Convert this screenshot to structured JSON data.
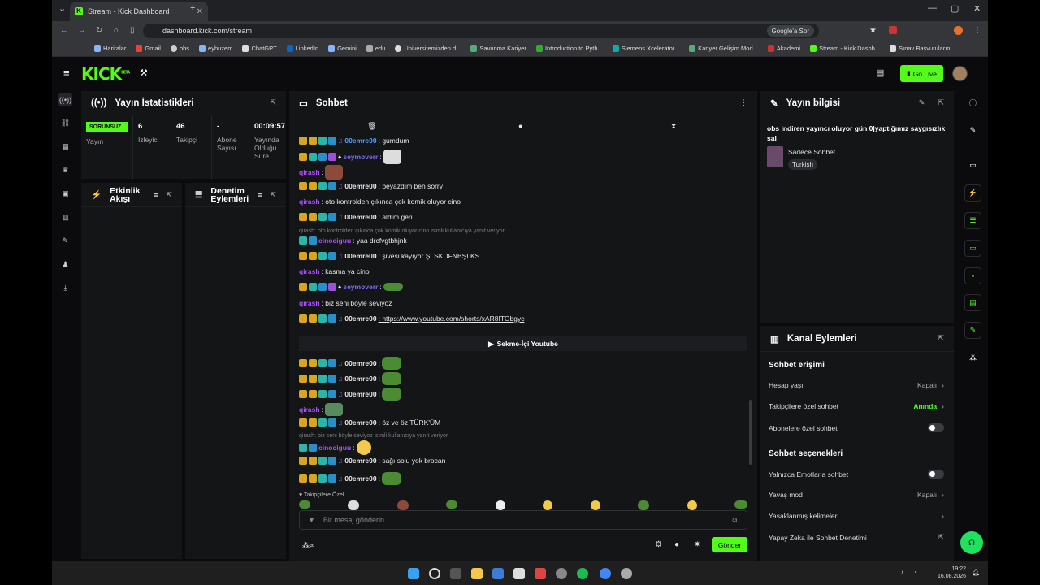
{
  "browser": {
    "tab_title": "Stream - Kick Dashboard",
    "url": "dashboard.kick.com/stream",
    "google_button": "Google'a Sor",
    "bookmarks": [
      "Haritalar",
      "Gmail",
      "obs",
      "eybuzem",
      "ChatGPT",
      "LinkedIn",
      "Gemini",
      "edu",
      "Üniversitemizden d...",
      "Savunma Kariyer",
      "Introduction to Pyth...",
      "Siemens Xcelerator...",
      "Kariyer Gelişim Mod...",
      "Akademi",
      "Stream - Kick Dashb...",
      "Sınav Başvurularını..."
    ]
  },
  "header": {
    "logo": "KICK",
    "logo_tag": "BETA",
    "go_live": "Go Live"
  },
  "stats": {
    "title": "Yayın İstatistikleri",
    "status_badge": "SORUNSUZ",
    "status_label": "Yayın",
    "viewers_value": "6",
    "viewers_label": "İzleyici",
    "followers_value": "46",
    "followers_label": "Takipçi",
    "subs_value": "-",
    "subs_label": "Abone Sayısı",
    "duration_value": "00:09:57",
    "duration_label": "Yayında Olduğu Süre"
  },
  "activity": {
    "title": "Etkinlik Akışı"
  },
  "moderation": {
    "title": "Denetim Eylemleri"
  },
  "chat": {
    "title": "Sohbet",
    "pinned": "Sekme-İçi Youtube",
    "followers_only": "Takipçilere Özel",
    "input_placeholder": "Bir mesaj gönderin",
    "send": "Gönder",
    "messages": [
      {
        "user": "00emre00",
        "text": ": gumdum",
        "color": "#4aa3ff"
      },
      {
        "user": "seymoverr",
        "text": ":",
        "color": "#7d6bff"
      },
      {
        "user": "qirash",
        "text": ":",
        "color": "#b04dff"
      },
      {
        "user": "00emre00",
        "text": ": beyazdım ben sorry",
        "color": "#fff"
      },
      {
        "user": "qirash",
        "text": ": oto kontrolden çıkınca çok komik oluyor cino",
        "color": "#b04dff"
      },
      {
        "user": "00emre00",
        "text": ": aldım geri",
        "color": "#fff"
      },
      {
        "reply": "qirash: oto kontrolden çıkınca çok komik oluyor cino isimli kullanıcıya yanıt veriyor"
      },
      {
        "user": "cinociguu",
        "text": ": yaa drcfvgtbhjnk",
        "color": "#b04dff"
      },
      {
        "user": "00emre00",
        "text": ": şivesi kayıyor ŞLSKDFNBŞLKS",
        "color": "#fff"
      },
      {
        "user": "qirash",
        "text": ": kasma ya cino",
        "color": "#b04dff"
      },
      {
        "user": "seymoverr",
        "text": ":",
        "color": "#7d6bff"
      },
      {
        "user": "qirash",
        "text": ": biz seni böyle seviyoz",
        "color": "#b04dff"
      },
      {
        "user": "00emre00",
        "text": ": https://www.youtube.com/shorts/xAR8ITObgyc",
        "color": "#fff"
      },
      {
        "user": "00emre00",
        "text": ":",
        "color": "#fff"
      },
      {
        "user": "00emre00",
        "text": ":",
        "color": "#fff"
      },
      {
        "user": "00emre00",
        "text": ":",
        "color": "#fff"
      },
      {
        "user": "qirash",
        "text": ":",
        "color": "#b04dff"
      },
      {
        "user": "00emre00",
        "text": ": öz ve öz TÜRK'ÜM",
        "color": "#fff"
      },
      {
        "reply": "qirash: biz seni böyle seviyoz isimli kullanıcıya yanıt veriyor"
      },
      {
        "user": "cinociguu",
        "text": ":",
        "color": "#b04dff"
      },
      {
        "user": "00emre00",
        "text": ": sağı solu yok brocan",
        "color": "#fff"
      },
      {
        "user": "00emre00",
        "text": ":",
        "color": "#fff"
      }
    ]
  },
  "stream_info": {
    "title": "Yayın bilgisi",
    "stream_title": "obs indiren yayıncı oluyor gün 0|yaptığımız saygısızlık sal",
    "category": "Sadece Sohbet",
    "language": "Turkish"
  },
  "channel_actions": {
    "title": "Kanal Eylemleri",
    "chat_access": "Sohbet erişimi",
    "account_age": "Hesap yaşı",
    "account_age_value": "Kapalı",
    "followers_chat": "Takipçilere özel sohbet",
    "followers_chat_value": "Anında",
    "subs_chat": "Abonelere özel sohbet",
    "chat_options": "Sohbet seçenekleri",
    "emote_only": "Yalnızca Emotlarla sohbet",
    "slow_mode": "Yavaş mod",
    "slow_mode_value": "Kapalı",
    "banned_words": "Yasaklanmış kelimeler",
    "ai_moderation": "Yapay Zeka ile Sohbet Denetimi"
  },
  "taskbar": {
    "time": "19:22",
    "date": "16.08.2026"
  },
  "colors": {
    "accent": "#53fc18"
  }
}
